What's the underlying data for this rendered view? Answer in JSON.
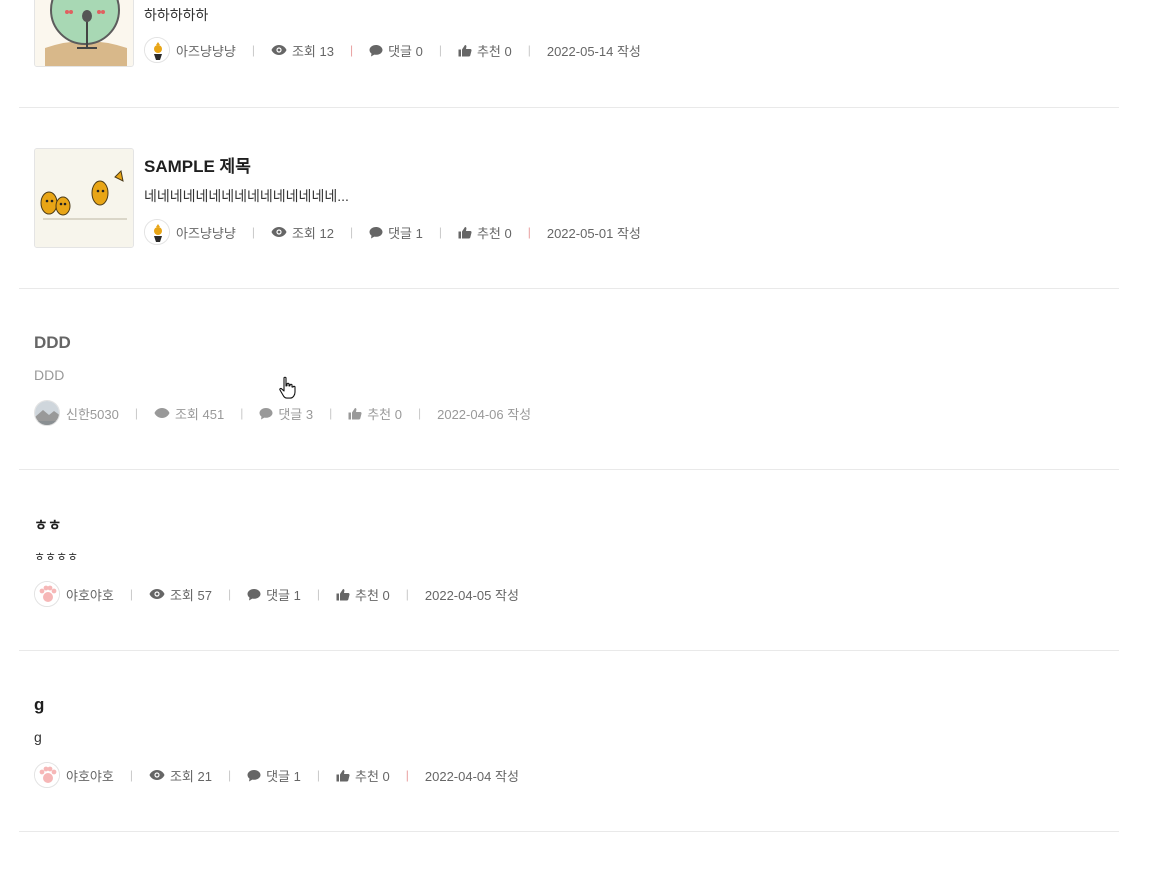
{
  "posts": [
    {
      "title": "",
      "excerpt": "하하하하하",
      "author": "아즈냥냥냥",
      "views_label": "조회 13",
      "comments_label": "댓글 0",
      "likes_label": "추천 0",
      "date_label": "2022-05-14 작성",
      "thumbnail": "cactus-character-microphone",
      "avatar": "bird-character-avatar"
    },
    {
      "title": "SAMPLE 제목",
      "excerpt": "네네네네네네네네네네네네네네네...",
      "author": "아즈냥냥냥",
      "views_label": "조회 12",
      "comments_label": "댓글 1",
      "likes_label": "추천 0",
      "date_label": "2022-05-01 작성",
      "thumbnail": "yellow-birds-illustration",
      "avatar": "bird-character-avatar"
    },
    {
      "title": "DDD",
      "excerpt": "DDD",
      "author": "신한5030",
      "views_label": "조회 451",
      "comments_label": "댓글 3",
      "likes_label": "추천 0",
      "date_label": "2022-04-06 작성",
      "avatar": "landscape-photo-avatar"
    },
    {
      "title": "ㅎㅎ",
      "excerpt": "ㅎㅎㅎㅎ",
      "author": "야호야호",
      "views_label": "조회 57",
      "comments_label": "댓글 1",
      "likes_label": "추천 0",
      "date_label": "2022-04-05 작성",
      "avatar": "pink-paw-avatar"
    },
    {
      "title": "g",
      "excerpt": "g",
      "author": "야호야호",
      "views_label": "조회 21",
      "comments_label": "댓글 1",
      "likes_label": "추천 0",
      "date_label": "2022-04-04 작성",
      "avatar": "pink-paw-avatar"
    }
  ],
  "icons": {
    "views": "eye-icon",
    "comments": "speech-bubble-icon",
    "likes": "thumbs-up-icon",
    "cursor": "hand-pointer-cursor-icon"
  },
  "colors": {
    "text": "#222222",
    "meta": "#666666",
    "separator": "#c9c9c9",
    "separator_accent": "#e9a1a1",
    "divider": "#e9e9e9"
  }
}
